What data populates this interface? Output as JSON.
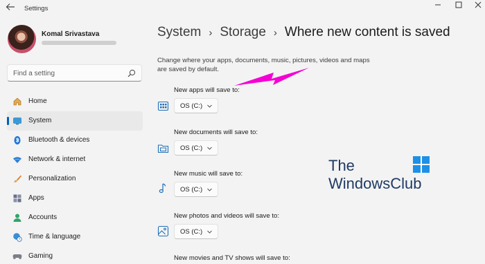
{
  "app": {
    "title": "Settings"
  },
  "user": {
    "name": "Komal Srivastava"
  },
  "search": {
    "placeholder": "Find a setting"
  },
  "nav": {
    "items": [
      {
        "label": "Home",
        "icon": "home-icon"
      },
      {
        "label": "System",
        "icon": "monitor-icon",
        "selected": true
      },
      {
        "label": "Bluetooth & devices",
        "icon": "bluetooth-icon"
      },
      {
        "label": "Network & internet",
        "icon": "wifi-icon"
      },
      {
        "label": "Personalization",
        "icon": "brush-icon"
      },
      {
        "label": "Apps",
        "icon": "apps-icon"
      },
      {
        "label": "Accounts",
        "icon": "person-icon"
      },
      {
        "label": "Time & language",
        "icon": "globe-clock-icon"
      },
      {
        "label": "Gaming",
        "icon": "gamepad-icon"
      }
    ]
  },
  "breadcrumb": {
    "part1": "System",
    "part2": "Storage",
    "current": "Where new content is saved"
  },
  "page": {
    "description": "Change where your apps, documents, music, pictures, videos and maps are saved by default.",
    "settings": [
      {
        "label": "New apps will save to:",
        "value": "OS (C:)",
        "icon": "apps-storage-icon"
      },
      {
        "label": "New documents will save to:",
        "value": "OS (C:)",
        "icon": "folder-icon"
      },
      {
        "label": "New music will save to:",
        "value": "OS (C:)",
        "icon": "music-note-icon"
      },
      {
        "label": "New photos and videos will save to:",
        "value": "OS (C:)",
        "icon": "photo-icon"
      },
      {
        "label": "New movies and TV shows will save to:"
      }
    ]
  },
  "watermark": {
    "line1": "The",
    "line2": "WindowsClub"
  },
  "colors": {
    "accent": "#005fb8",
    "annotation_arrow": "#f500d4",
    "background": "#f3f3f3"
  }
}
